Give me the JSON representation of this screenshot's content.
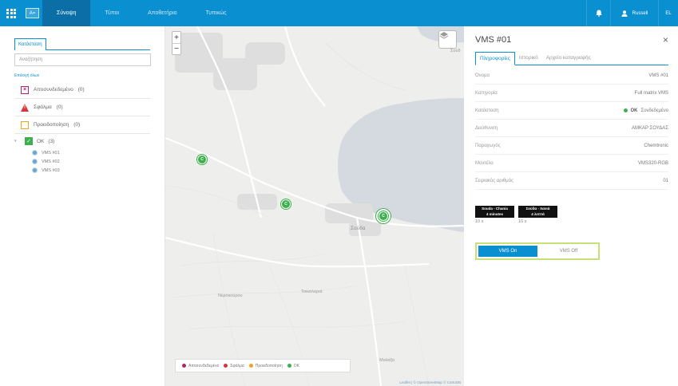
{
  "nav": {
    "card_label": "A=",
    "tabs": [
      {
        "label": "Σύνοψη",
        "active": true
      },
      {
        "label": "Τύποι",
        "active": false
      },
      {
        "label": "Αποθετήριο",
        "active": false
      },
      {
        "label": "Τυπικώς",
        "active": false
      }
    ],
    "user_label": "Russell",
    "lang_label": "EL",
    "accent": "#0a8fd0"
  },
  "left": {
    "tab_label": "Κατάσταση",
    "search_placeholder": "Αναζήτηση",
    "select_all": "Επιλογή όλων",
    "categories": [
      {
        "icon": "disconnected-icon",
        "label": "Αποσυνδεδεμένο",
        "count": "(0)",
        "color": "#b3246a"
      },
      {
        "icon": "error-icon",
        "label": "Σφάλμα",
        "count": "(0)",
        "color": "#d9343a"
      },
      {
        "icon": "warning-icon",
        "label": "Προειδοποίηση",
        "count": "(0)",
        "color": "#f0a324"
      }
    ],
    "ok": {
      "label": "OK",
      "count": "(3)",
      "color": "#3cb04c"
    },
    "devices": [
      "VMS #01",
      "VMS #02",
      "VMS #03"
    ]
  },
  "map": {
    "labels": {
      "town": "Σούδα",
      "village1": "Νεροκούρου",
      "village2": "Τσικαλαριά",
      "village3": "Μαλάξα",
      "corner": "Σούδ"
    },
    "legend": [
      {
        "label": "Αποσυνδεδεμένο",
        "color": "#b3246a"
      },
      {
        "label": "Σφάλμα",
        "color": "#d9343a"
      },
      {
        "label": "Προειδοποίηση",
        "color": "#f0a324"
      },
      {
        "label": "OK",
        "color": "#3cb04c"
      }
    ],
    "attribution": "Leaflet | © OpenStreetMap © CartoDB",
    "markers": [
      "VMS #01",
      "VMS #02",
      "VMS #03"
    ],
    "marker_symbol": "C"
  },
  "panel": {
    "title": "VMS #01",
    "tabs": [
      {
        "label": "Πληροφορίες",
        "active": true
      },
      {
        "label": "Ιστορικό",
        "active": false
      },
      {
        "label": "Αρχείο καταγραφής",
        "active": false
      }
    ],
    "rows": [
      {
        "key": "Όνομα",
        "value": "VMS #01"
      },
      {
        "key": "Κατηγορία",
        "value": "Full matrix VMS"
      },
      {
        "key": "Κατάσταση",
        "value": "Συνδεδεμένο",
        "status": "OK"
      },
      {
        "key": "Διεύθυνση",
        "value": "ΑΜΚΑΡ ΣΟΥΔΑΣ"
      },
      {
        "key": "Παραγωγός",
        "value": "Chemtronic"
      },
      {
        "key": "Μοντέλο",
        "value": "VMS320-RGB"
      },
      {
        "key": "Σειριακός αριθμός",
        "value": "01"
      }
    ],
    "signs": [
      {
        "line1": "Souda - Chania",
        "line2": "4 minutes",
        "duration": "10 s"
      },
      {
        "line1": "Σούδα - Χανιά",
        "line2": "4 λεπτά",
        "duration": "10 s"
      }
    ],
    "toggle": {
      "on_label": "VMS On",
      "off_label": "VMS Off"
    }
  }
}
